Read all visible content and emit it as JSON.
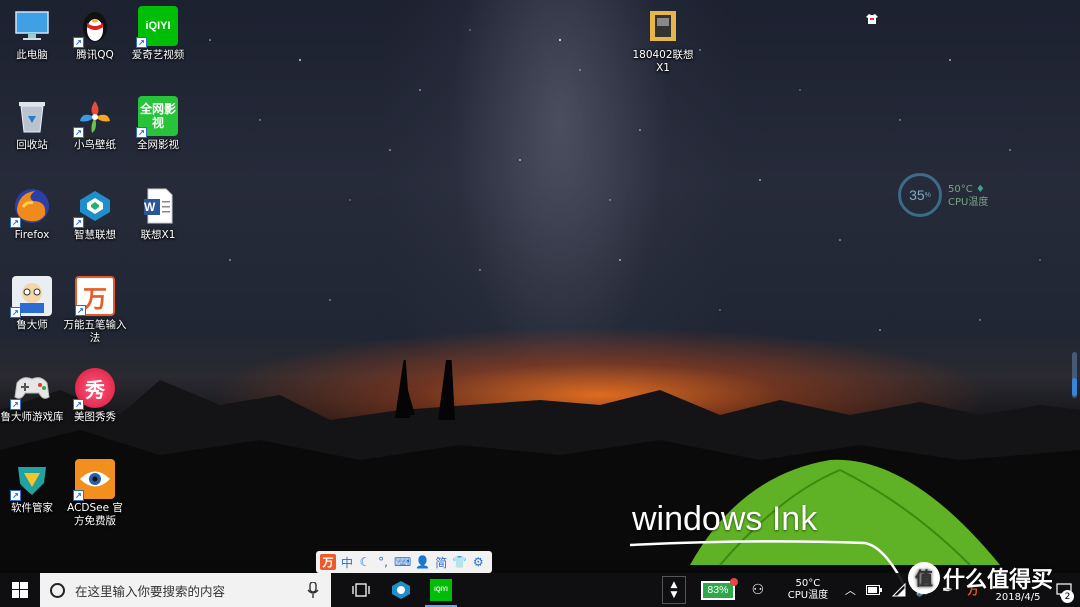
{
  "desktop": {
    "icons": [
      {
        "label": "此电脑",
        "icon": "computer-icon"
      },
      {
        "label": "腾讯QQ",
        "icon": "qq-penguin-icon"
      },
      {
        "label": "爱奇艺视频",
        "icon": "iqiyi-icon",
        "glyph": "iQIYI"
      },
      {
        "label": "回收站",
        "icon": "recycle-bin-icon"
      },
      {
        "label": "小鸟壁纸",
        "icon": "bird-wallpaper-icon"
      },
      {
        "label": "全网影视",
        "icon": "video-app-icon",
        "glyph": "全网影视"
      },
      {
        "label": "Firefox",
        "icon": "firefox-icon"
      },
      {
        "label": "智慧联想",
        "icon": "lenovo-smart-icon"
      },
      {
        "label": "联想X1",
        "icon": "word-document-icon",
        "glyph": "W"
      },
      {
        "label": "鲁大师",
        "icon": "ludashi-icon"
      },
      {
        "label": "万能五笔输入法",
        "icon": "wubi-ime-icon",
        "glyph": "万"
      },
      {
        "label": "鲁大师游戏库",
        "icon": "gamepad-icon"
      },
      {
        "label": "美图秀秀",
        "icon": "meitu-icon",
        "glyph": "秀"
      },
      {
        "label": "软件管家",
        "icon": "software-manager-icon"
      },
      {
        "label": "ACDSee 官方免费版",
        "icon": "acdsee-eye-icon"
      },
      {
        "label": "180402联想X1",
        "icon": "folder-icon"
      }
    ]
  },
  "cpu_widget": {
    "load": "35",
    "load_unit": "%",
    "temp": "50°C",
    "temp_label": "CPU温度"
  },
  "annotation": {
    "text": "windows Ink"
  },
  "ime_bar": {
    "logo": "万",
    "mode": "中",
    "simp": "简"
  },
  "taskbar": {
    "search_placeholder": "在这里输入你要搜索的内容",
    "pinned": [
      "task-view-icon",
      "lenovo-app-icon",
      "iqiyi-taskbar-icon"
    ],
    "iqiyi_glyph": "iQIYI"
  },
  "tray": {
    "battery_percent": "83%",
    "temp": "50°C",
    "temp_label": "CPU温度",
    "date": "2018/4/5",
    "notification_count": "2"
  },
  "watermark": {
    "badge": "值",
    "text": "什么值得买"
  },
  "colors": {
    "accent": "#2b6cc4",
    "battery": "#2ea84a",
    "iqiyi": "#00be06"
  }
}
